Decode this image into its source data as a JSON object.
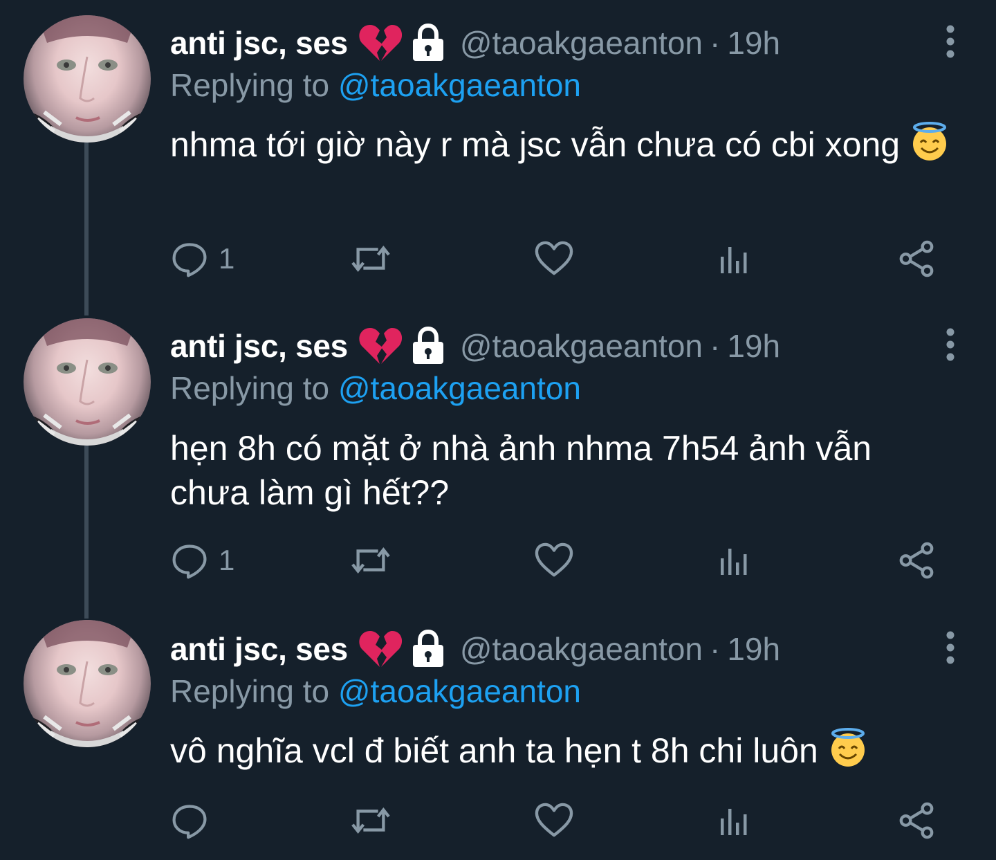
{
  "colors": {
    "background": "#15202b",
    "secondary_text": "#8899a6",
    "link": "#1da1f2",
    "thread_line": "#3d4b58"
  },
  "tweets": [
    {
      "display_name": "anti jsc, ses",
      "name_emoji": "broken-heart",
      "protected_icon": "lock-icon",
      "handle": "@taoakgaeanton",
      "separator": "·",
      "time": "19h",
      "replying_prefix": "Replying to",
      "replying_to": "@taoakgaeanton",
      "text": "nhma tới giờ này r mà jsc vẫn chưa có cbi xong",
      "text_emoji": "smiling-face-with-halo",
      "reply_count": "1"
    },
    {
      "display_name": "anti jsc, ses",
      "name_emoji": "broken-heart",
      "protected_icon": "lock-icon",
      "handle": "@taoakgaeanton",
      "separator": "·",
      "time": "19h",
      "replying_prefix": "Replying to",
      "replying_to": "@taoakgaeanton",
      "text": "hẹn 8h có mặt ở nhà ảnh nhma 7h54 ảnh vẫn chưa làm gì hết??",
      "text_emoji": "",
      "reply_count": "1"
    },
    {
      "display_name": "anti jsc, ses",
      "name_emoji": "broken-heart",
      "protected_icon": "lock-icon",
      "handle": "@taoakgaeanton",
      "separator": "·",
      "time": "19h",
      "replying_prefix": "Replying to",
      "replying_to": "@taoakgaeanton",
      "text": "vô nghĩa vcl đ biết anh ta hẹn t 8h chi luôn",
      "text_emoji": "smiling-face-with-halo",
      "reply_count": ""
    }
  ]
}
